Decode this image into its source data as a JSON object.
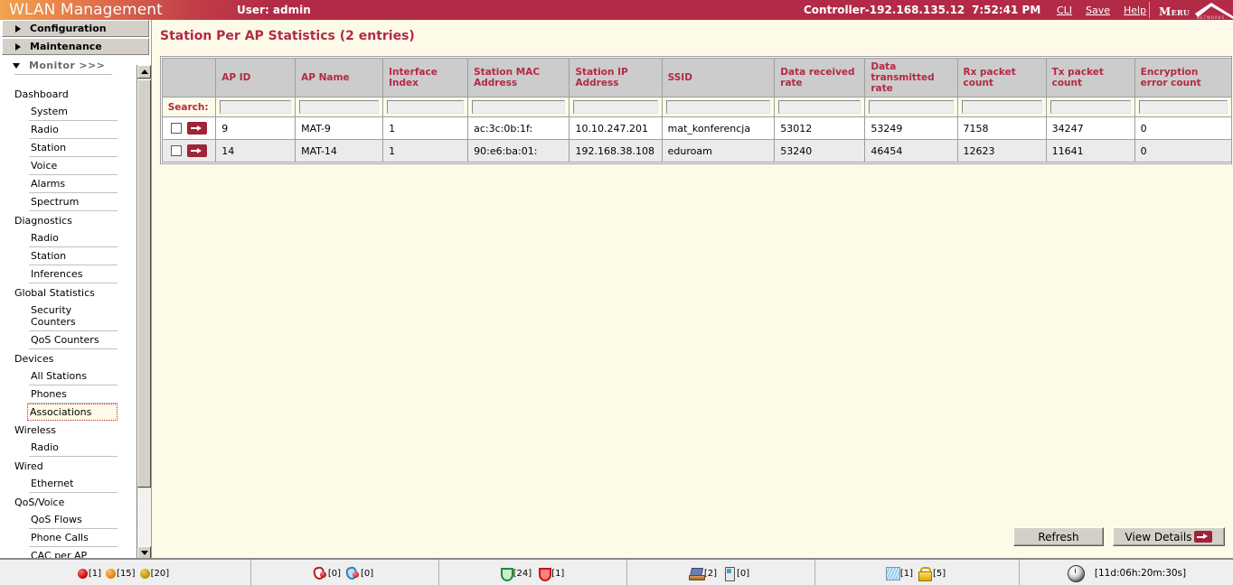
{
  "header": {
    "app_title": "WLAN Management",
    "user_label": "User: admin",
    "controller": "Controller-192.168.135.12",
    "time": "7:52:41 PM",
    "links": {
      "cli": "CLI",
      "save": "Save",
      "help": "Help"
    },
    "logo": {
      "word": "Meru",
      "sub": "NETWORKS"
    },
    "accent_red": "#b22a46"
  },
  "sidebar": {
    "buttons": [
      {
        "label": "Configuration",
        "icon": "triangle-right-icon"
      },
      {
        "label": "Maintenance",
        "icon": "triangle-right-icon"
      }
    ],
    "monitor": {
      "label": "Monitor >>>",
      "icon": "triangle-down-icon"
    },
    "groups": [
      {
        "title": "Dashboard",
        "items": [
          "System",
          "Radio",
          "Station",
          "Voice",
          "Alarms",
          "Spectrum"
        ]
      },
      {
        "title": "Diagnostics",
        "items": [
          "Radio",
          "Station",
          "Inferences"
        ]
      },
      {
        "title": "Global Statistics",
        "items": [
          "Security Counters",
          "QoS Counters"
        ]
      },
      {
        "title": "Devices",
        "items": [
          "All Stations",
          "Phones",
          "Associations"
        ]
      },
      {
        "title": "Wireless",
        "items": [
          "Radio"
        ]
      },
      {
        "title": "Wired",
        "items": [
          "Ethernet"
        ]
      },
      {
        "title": "QoS/Voice",
        "items": [
          "QoS Flows",
          "Phone Calls",
          "CAC per AP"
        ]
      }
    ],
    "selected_item": "Associations"
  },
  "main": {
    "page_title": "Station Per AP Statistics (2 entries)",
    "table": {
      "search_label": "Search:",
      "search_placeholder": "",
      "columns": [
        "AP ID",
        "AP Name",
        "Interface Index",
        "Station MAC Address",
        "Station IP Address",
        "SSID",
        "Data received rate",
        "Data transmitted rate",
        "Rx packet count",
        "Tx packet count",
        "Encryption error count"
      ],
      "search_values": [
        "",
        "",
        "",
        "",
        "",
        "",
        "",
        "",
        "",
        "",
        ""
      ],
      "rows": [
        {
          "selected": false,
          "cells": [
            "9",
            "MAT-9",
            "1",
            "ac:3c:0b:1f:",
            "10.10.247.201",
            "mat_konferencja",
            "53012",
            "53249",
            "7158",
            "34247",
            "0"
          ]
        },
        {
          "selected": false,
          "cells": [
            "14",
            "MAT-14",
            "1",
            "90:e6:ba:01:",
            "192.168.38.108",
            "eduroam",
            "53240",
            "46454",
            "12623",
            "11641",
            "0"
          ]
        }
      ]
    },
    "buttons": {
      "refresh": "Refresh",
      "view_details": "View Details"
    }
  },
  "statusbar": {
    "cells": [
      {
        "items": [
          {
            "icon": "alarm-critical-dot-icon",
            "count": "[1]"
          },
          {
            "icon": "alarm-major-dot-icon",
            "count": "[15]"
          },
          {
            "icon": "alarm-minor-dot-icon",
            "count": "[20]"
          }
        ]
      },
      {
        "items": [
          {
            "icon": "ap-down-icon",
            "count": "[0]"
          },
          {
            "icon": "ap-alert-icon",
            "count": "[0]"
          }
        ]
      },
      {
        "items": [
          {
            "icon": "radio-up-icon",
            "count": "[24]"
          },
          {
            "icon": "radio-down-icon",
            "count": "[1]"
          }
        ]
      },
      {
        "items": [
          {
            "icon": "station-laptop-icon",
            "count": "[2]"
          },
          {
            "icon": "station-phone-icon",
            "count": "[0]"
          }
        ]
      },
      {
        "items": [
          {
            "icon": "network-map-icon",
            "count": "[1]"
          },
          {
            "icon": "security-lock-icon",
            "count": "[5]"
          }
        ]
      },
      {
        "items": [
          {
            "icon": "uptime-watch-icon",
            "count": ""
          }
        ],
        "uptime": "[11d:06h:20m:30s]"
      }
    ]
  }
}
